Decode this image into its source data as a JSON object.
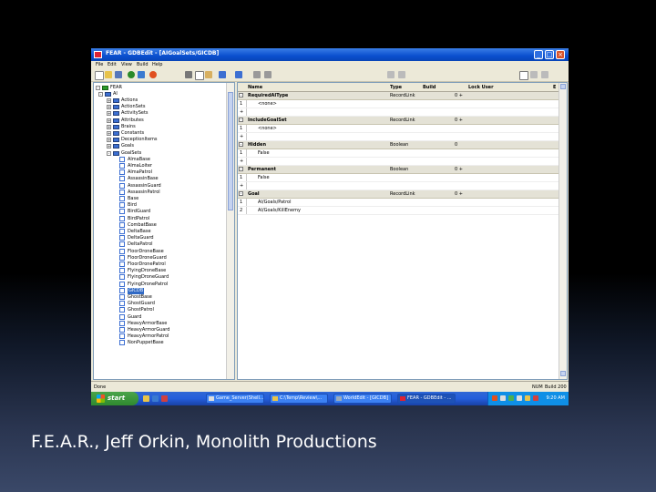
{
  "window": {
    "title": "FEAR - GDBEdit - [AIGoalSets/GICDB]",
    "buttons": {
      "minimize": "_",
      "maximize": "□",
      "close": "×"
    }
  },
  "menu": [
    "File",
    "Edit",
    "View",
    "Build",
    "Help"
  ],
  "tree": {
    "root": "FEAR",
    "ai": "AI",
    "folders": [
      "Actions",
      "ActionSets",
      "ActivitySets",
      "Attributes",
      "Brains",
      "Constants",
      "DeceptionItems",
      "Goals",
      "GoalSets"
    ],
    "goalsets": [
      "AlmaBase",
      "AlmaLoiter",
      "AlmaPatrol",
      "AssassinBase",
      "AssassinGuard",
      "AssassinPatrol",
      "Base",
      "Bird",
      "BirdGuard",
      "BirdPatrol",
      "CombatBase",
      "DeltaBase",
      "DeltaGuard",
      "DeltaPatrol",
      "FloorDroneBase",
      "FloorDroneGuard",
      "FloorDronePatrol",
      "FlyingDroneBase",
      "FlyingDroneGuard",
      "FlyingDronePatrol",
      "GICDB",
      "GhostBase",
      "GhostGuard",
      "GhostPatrol",
      "Guard",
      "HeavyArmorBase",
      "HeavyArmorGuard",
      "HeavyArmorPatrol",
      "NonPuppetBase"
    ],
    "selected": "GICDB"
  },
  "grid": {
    "headers": {
      "name": "Name",
      "type": "Type",
      "build": "Build",
      "lock": "Lock User",
      "e": "E"
    },
    "properties": [
      {
        "name": "RequiredAIType",
        "type": "RecordLink",
        "lock": "0 +",
        "values": [
          "<none>"
        ]
      },
      {
        "name": "IncludeGoalSet",
        "type": "RecordLink",
        "lock": "0 +",
        "values": [
          "<none>"
        ]
      },
      {
        "name": "Hidden",
        "type": "Boolean",
        "lock": "0",
        "values": [
          "False"
        ]
      },
      {
        "name": "Permanent",
        "type": "Boolean",
        "lock": "0 +",
        "values": [
          "False"
        ]
      },
      {
        "name": "Goal",
        "type": "RecordLink",
        "lock": "0 +",
        "values": [
          "AI/Goals/Patrol",
          "AI/Goals/KillEnemy"
        ]
      }
    ]
  },
  "status": {
    "left": "Done",
    "num": "NUM",
    "build": "Build 200"
  },
  "taskbar": {
    "start": "start",
    "tasks": [
      "Game_Server(Shell...",
      "C:\\Temp\\Review\\...",
      "WorldEdit - [GICDB]",
      "FEAR - GDBEdit - ..."
    ],
    "clock": "9:20 AM"
  },
  "caption": "F.E.A.R., Jeff Orkin, Monolith Productions",
  "colors": {
    "titlebar": "#0a4fcf",
    "taskbar": "#245edb",
    "selection": "#316ac5",
    "start": "#2f8a2f"
  }
}
